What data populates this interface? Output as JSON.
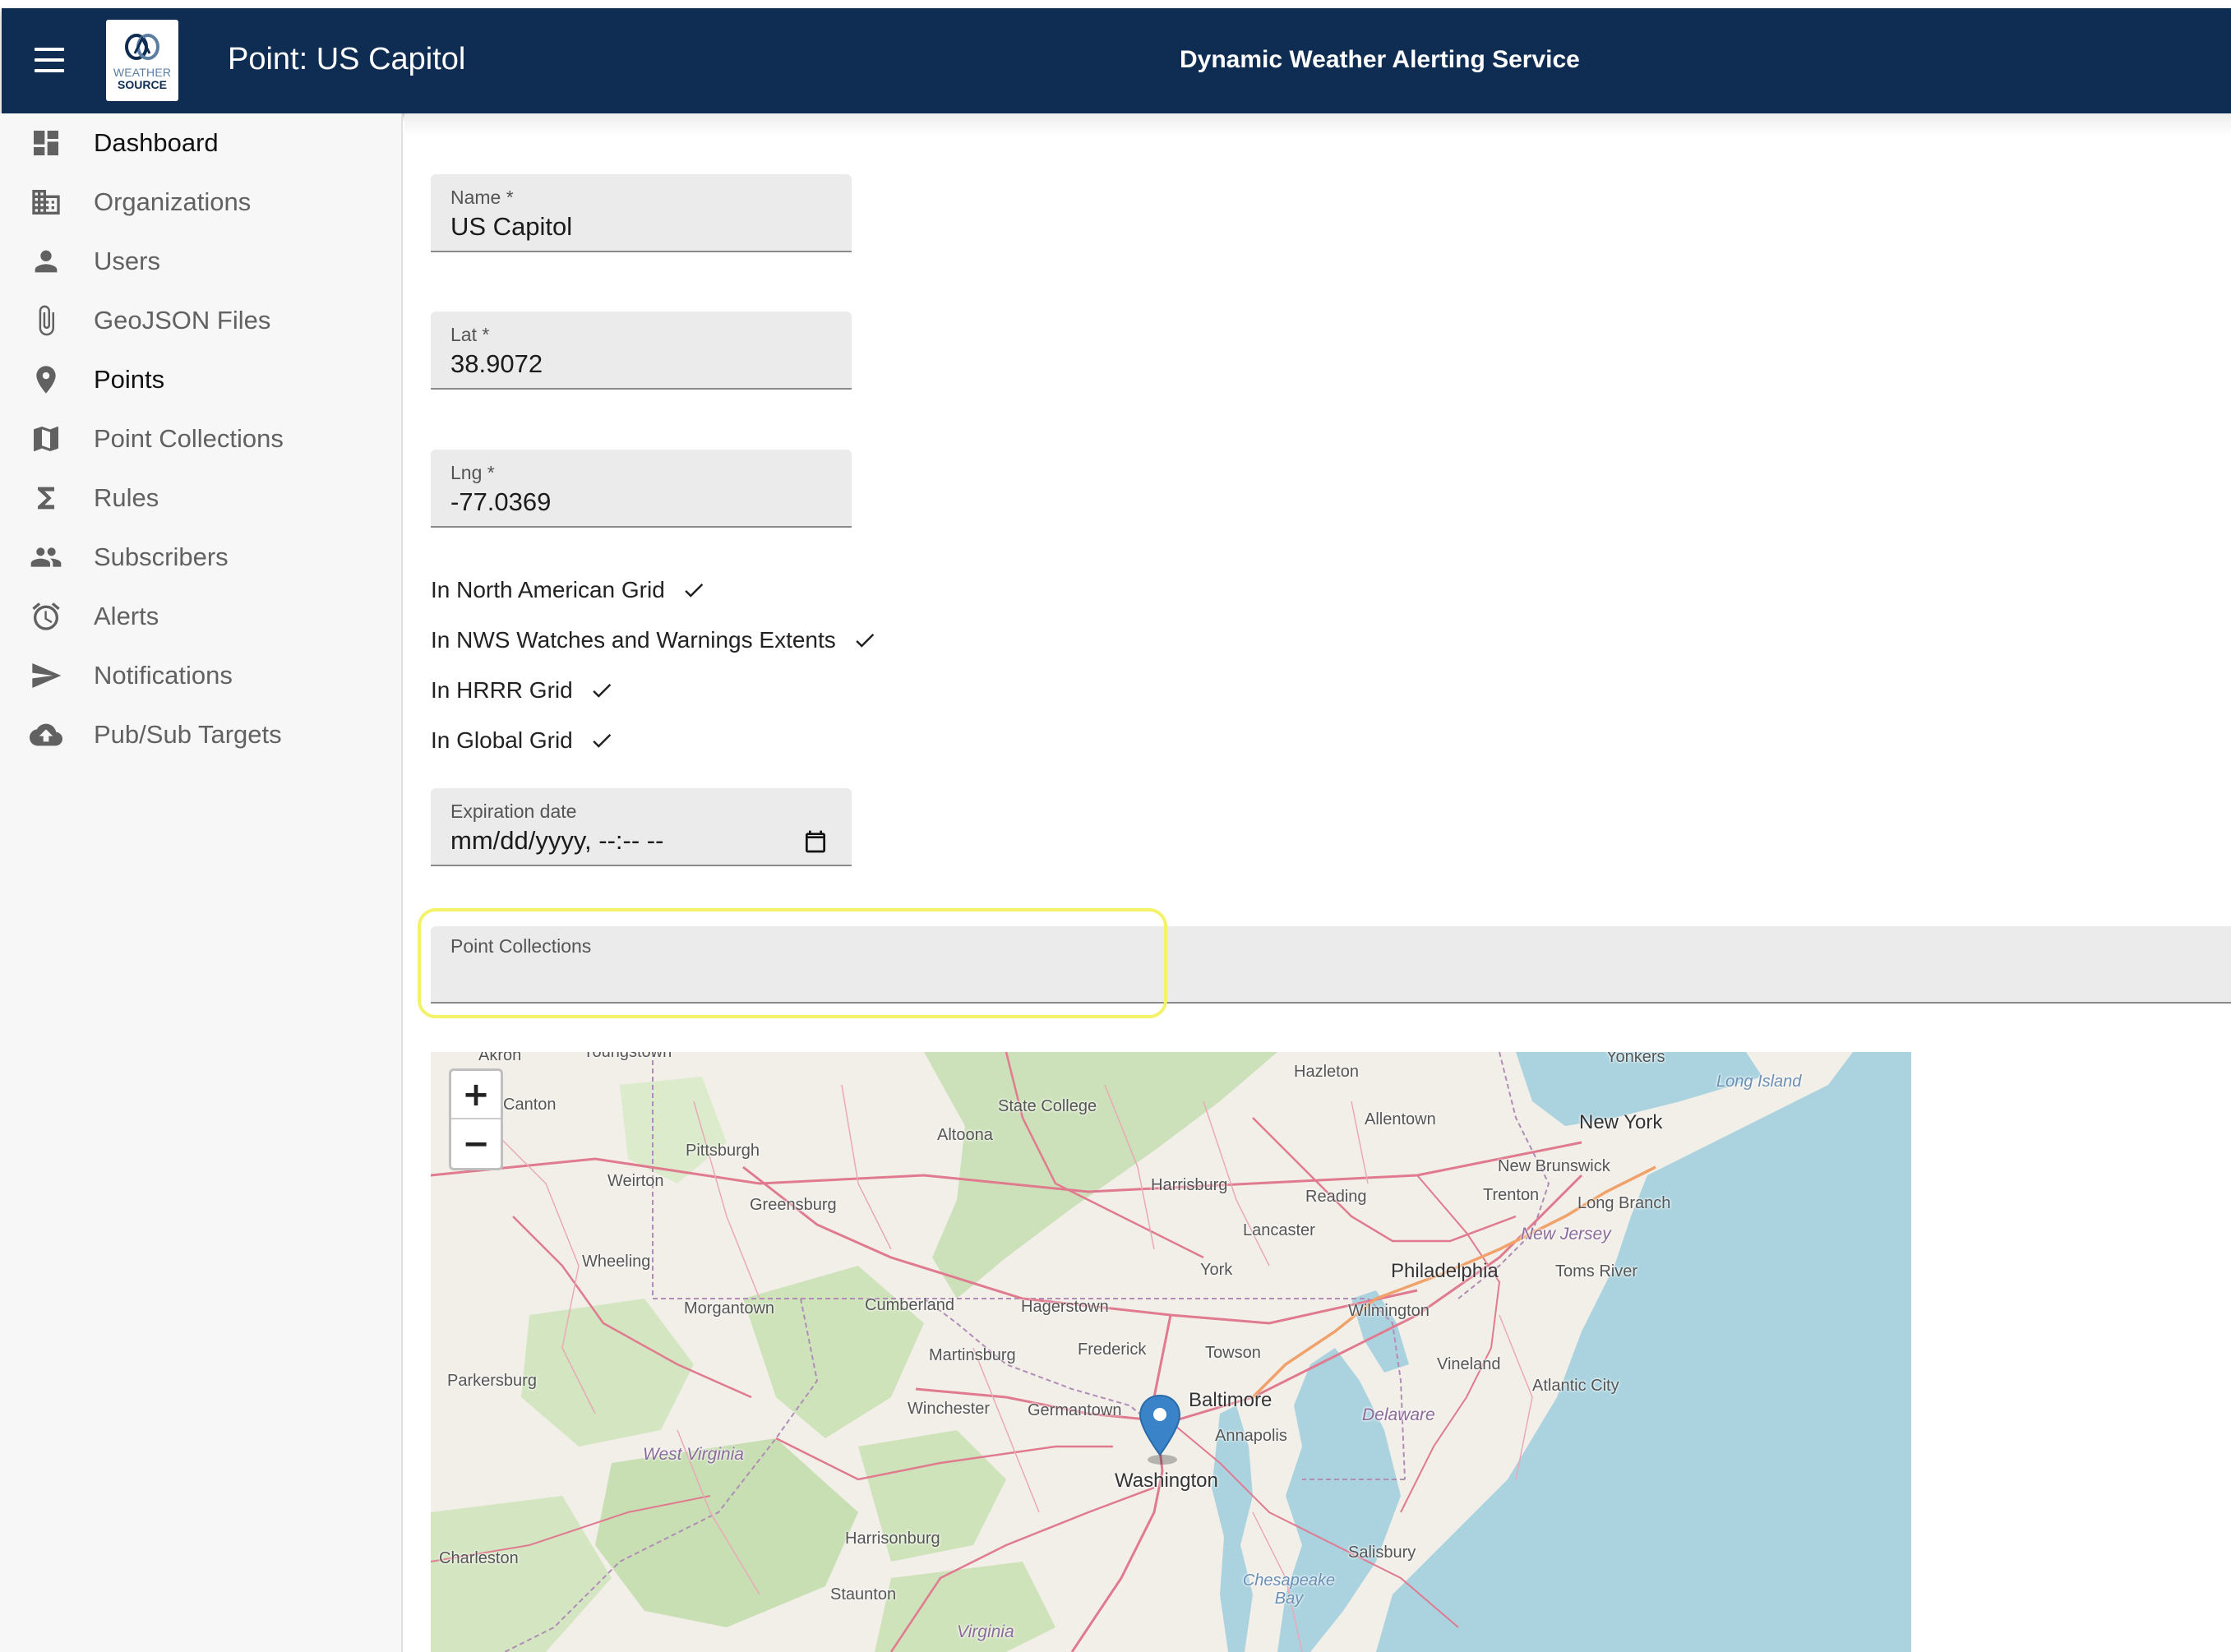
{
  "header": {
    "page_title": "Point: US Capitol",
    "service_title": "Dynamic Weather Alerting Service",
    "logo_line1": "WEATHER",
    "logo_line2": "SOURCE"
  },
  "sidebar": {
    "items": [
      {
        "label": "Dashboard",
        "icon": "dashboard-icon"
      },
      {
        "label": "Organizations",
        "icon": "building-icon"
      },
      {
        "label": "Users",
        "icon": "person-icon"
      },
      {
        "label": "GeoJSON Files",
        "icon": "paperclip-icon"
      },
      {
        "label": "Points",
        "icon": "location-pin-icon"
      },
      {
        "label": "Point Collections",
        "icon": "map-icon"
      },
      {
        "label": "Rules",
        "icon": "sigma-icon"
      },
      {
        "label": "Subscribers",
        "icon": "people-icon"
      },
      {
        "label": "Alerts",
        "icon": "alarm-clock-icon"
      },
      {
        "label": "Notifications",
        "icon": "send-icon"
      },
      {
        "label": "Pub/Sub Targets",
        "icon": "cloud-upload-icon"
      }
    ]
  },
  "form": {
    "name": {
      "label": "Name *",
      "value": "US Capitol"
    },
    "lat": {
      "label": "Lat *",
      "value": "38.9072"
    },
    "lng": {
      "label": "Lng *",
      "value": "-77.0369"
    },
    "checks": [
      {
        "label": "In North American Grid",
        "checked": true
      },
      {
        "label": "In NWS Watches and Warnings Extents",
        "checked": true
      },
      {
        "label": "In HRRR Grid",
        "checked": true
      },
      {
        "label": "In Global Grid",
        "checked": true
      }
    ],
    "expiration": {
      "label": "Expiration date",
      "placeholder": "mm/dd/yyyy, --:-- --"
    },
    "point_collections": {
      "label": "Point Collections"
    }
  },
  "map": {
    "zoom_in": "+",
    "zoom_out": "−",
    "labels": {
      "akron": "Akron",
      "youngstown": "Youngstown",
      "canton": "Canton",
      "yonkers": "Yonkers",
      "hazleton": "Hazleton",
      "state_college": "State College",
      "long_island": "Long Island",
      "altoona": "Altoona",
      "allentown": "Allentown",
      "new_york": "New York",
      "pittsburgh": "Pittsburgh",
      "weirton": "Weirton",
      "new_brunswick": "New Brunswick",
      "harrisburg": "Harrisburg",
      "reading": "Reading",
      "trenton": "Trenton",
      "long_branch": "Long Branch",
      "greensburg": "Greensburg",
      "lancaster": "Lancaster",
      "new_jersey": "New Jersey",
      "wheeling": "Wheeling",
      "york": "York",
      "philadelphia": "Philadelphia",
      "toms_river": "Toms River",
      "morgantown": "Morgantown",
      "cumberland": "Cumberland",
      "hagerstown": "Hagerstown",
      "wilmington": "Wilmington",
      "martinsburg": "Martinsburg",
      "frederick": "Frederick",
      "towson": "Towson",
      "vineland": "Vineland",
      "parkersburg": "Parkersburg",
      "atlantic_city": "Atlantic City",
      "baltimore": "Baltimore",
      "winchester": "Winchester",
      "germantown": "Germantown",
      "delaware": "Delaware",
      "annapolis": "Annapolis",
      "west_virginia": "West Virginia",
      "washington": "Washington",
      "harrisonburg": "Harrisonburg",
      "salisbury": "Salisbury",
      "charleston": "Charleston",
      "chesapeake_bay": "Chesapeake Bay",
      "staunton": "Staunton",
      "virginia": "Virginia"
    }
  },
  "colors": {
    "appbar": "#0f2d53",
    "highlight": "#f3f36a",
    "marker": "#3a83c9",
    "water": "#aad3df"
  }
}
